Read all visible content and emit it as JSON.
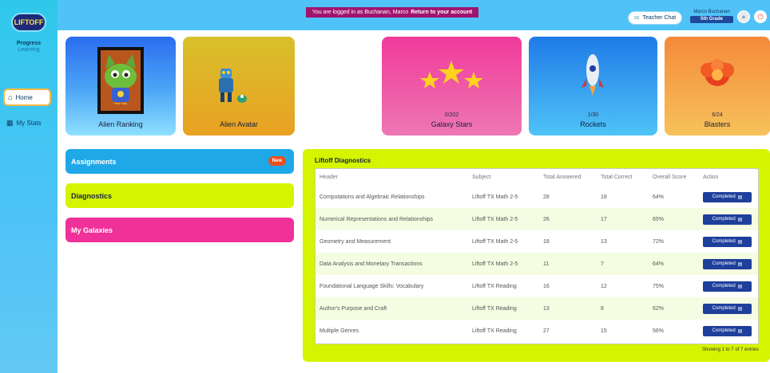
{
  "sidebar": {
    "logo": "LIFTOFF",
    "brand_line1": "Progress",
    "brand_line2": "Learning",
    "items": [
      {
        "label": "Home",
        "icon": "house-icon"
      },
      {
        "label": "My Stats",
        "icon": "stats-icon"
      }
    ]
  },
  "topbar": {
    "login_notice": "You are logged in as Buchanan, Marco",
    "return_link": "Return to your account",
    "teacher_chat": "Teacher Chat",
    "user_name": "Marco Buchanan",
    "grade": "5th Grade"
  },
  "cards": {
    "alien_ranking": {
      "label": "Alien Ranking",
      "poster_caption": "Star Kitty"
    },
    "alien_avatar": {
      "label": "Alien Avatar"
    },
    "galaxy_stars": {
      "label": "Galaxy Stars",
      "count": "0/202"
    },
    "rockets": {
      "label": "Rockets",
      "count": "1/30"
    },
    "blasters": {
      "label": "Blasters",
      "count": "6/24"
    }
  },
  "sections": {
    "assignments": "Assignments",
    "assignments_badge": "New",
    "diagnostics": "Diagnostics",
    "galaxies": "My Galaxies"
  },
  "diagnostics": {
    "title": "Liftoff Diagnostics",
    "columns": [
      "Header",
      "Subject",
      "Total Answered",
      "Total Correct",
      "Overall Score",
      "Action"
    ],
    "rows": [
      {
        "header": "Computations and Algebraic Relationships",
        "subject": "Liftoff TX Math 2-5",
        "answered": "28",
        "correct": "18",
        "score": "64%",
        "action": "Completed"
      },
      {
        "header": "Numerical Representations and Relationships",
        "subject": "Liftoff TX Math 2-5",
        "answered": "26",
        "correct": "17",
        "score": "65%",
        "action": "Completed"
      },
      {
        "header": "Geometry and Measurement",
        "subject": "Liftoff TX Math 2-5",
        "answered": "18",
        "correct": "13",
        "score": "72%",
        "action": "Completed"
      },
      {
        "header": "Data Analysis and Monetary Transactions",
        "subject": "Liftoff TX Math 2-5",
        "answered": "11",
        "correct": "7",
        "score": "64%",
        "action": "Completed"
      },
      {
        "header": "Foundational Language Skills: Vocabulary",
        "subject": "Liftoff TX Reading",
        "answered": "16",
        "correct": "12",
        "score": "75%",
        "action": "Completed"
      },
      {
        "header": "Author's Purpose and Craft",
        "subject": "Liftoff TX Reading",
        "answered": "13",
        "correct": "8",
        "score": "62%",
        "action": "Completed"
      },
      {
        "header": "Multiple Genres",
        "subject": "Liftoff TX Reading",
        "answered": "27",
        "correct": "15",
        "score": "56%",
        "action": "Completed"
      }
    ],
    "footer": "Showing 1 to 7 of 7 entries"
  },
  "colors": {
    "topbar": "#4fc3f7",
    "impersonate_bar": "#a0146e",
    "diagnostics_panel": "#d5f400",
    "assignments_bar": "#1fa8e8",
    "diagnostics_bar": "#d5f400",
    "galaxies_bar": "#f0319a",
    "completed_button": "#1e3f9b"
  }
}
